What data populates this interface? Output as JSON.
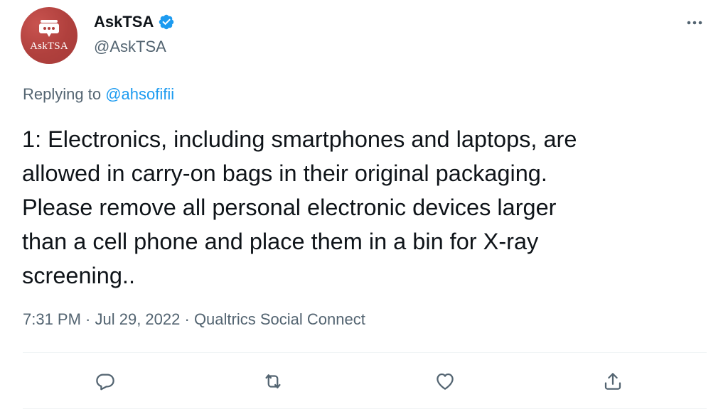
{
  "author": {
    "avatar_text": "AskTSA",
    "avatar_icon": "chat-bubble-badge-icon",
    "display_name": "AskTSA",
    "verified_icon": "verified-badge-icon",
    "handle": "@AskTSA"
  },
  "more_icon": "more-dots-icon",
  "reply_context": {
    "prefix": "Replying to ",
    "mention": "@ahsofifii"
  },
  "tweet_text": "1: Electronics, including smartphones and laptops, are\nallowed in carry-on bags in their original packaging.\nPlease remove all personal electronic devices larger\nthan a cell phone and place them in a bin for X-ray\nscreening..",
  "meta": {
    "time": "7:31 PM",
    "sep1": " · ",
    "date": "Jul 29, 2022",
    "sep2": " · ",
    "source": "Qualtrics Social Connect"
  },
  "actions": [
    {
      "name": "reply",
      "icon": "reply-icon"
    },
    {
      "name": "retweet",
      "icon": "retweet-icon"
    },
    {
      "name": "like",
      "icon": "heart-icon"
    },
    {
      "name": "share",
      "icon": "share-icon"
    }
  ],
  "colors": {
    "text_primary": "#0f1419",
    "text_secondary": "#536471",
    "link": "#1d9bf0",
    "avatar_bg": "#b0403d",
    "verified": "#1d9bf0"
  }
}
